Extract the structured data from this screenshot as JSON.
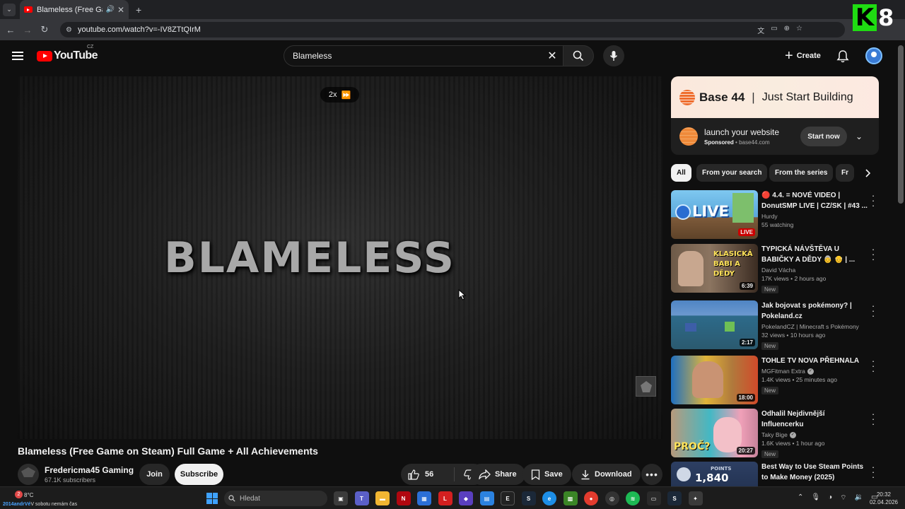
{
  "browser": {
    "tab_title": "Blameless (Free Game on Steam) Full Game + All Achievements",
    "url": "youtube.com/watch?v=-IV8ZTtQIrM",
    "badge_letter": "K",
    "badge_number": "8"
  },
  "header": {
    "logo_text": "YouTube",
    "country_code": "CZ",
    "search_value": "Blameless",
    "create_label": "Create"
  },
  "player": {
    "speed_label": "2x",
    "frame_title": "BLAMELESS"
  },
  "video": {
    "title": "Blameless (Free Game on Steam) Full Game + All Achievements",
    "channel": "Fredericma45 Gaming",
    "subscribers": "67.1K subscribers",
    "join_label": "Join",
    "subscribe_label": "Subscribe",
    "likes": "56",
    "share_label": "Share",
    "save_label": "Save",
    "download_label": "Download"
  },
  "ad": {
    "brand": "Base 44",
    "separator": "|",
    "tagline": "Just Start Building",
    "headline": "launch your website",
    "sponsored": "Sponsored",
    "dot": "•",
    "domain": "base44.com",
    "cta": "Start now"
  },
  "chips": [
    "All",
    "From your search",
    "From the series",
    "Fr"
  ],
  "recommendations": [
    {
      "title": "🔴 4.4. = NOVÉ VIDEO | DonutSMP LIVE | CZ/SK | #43 ...",
      "channel": "Hurdy",
      "stats": "55 watching",
      "badge": "LIVE",
      "thumb_text": "LIVE",
      "new": ""
    },
    {
      "title": "TYPICKÁ NÁVŠTĚVA U BABIČKY A DĚDY 👵 👴 | ...",
      "channel": "David Vácha",
      "stats": "17K views • 2 hours ago",
      "badge": "6:39",
      "thumb_text": "KLASICKÁ BABI A DĚDY",
      "new": "New"
    },
    {
      "title": "Jak bojovat s pokémony? | Pokeland.cz",
      "channel": "PokelandCZ | Minecraft s Pokémony",
      "stats": "32 views • 10 hours ago",
      "badge": "2:17",
      "thumb_text": "",
      "new": "New"
    },
    {
      "title": "TOHLE TV NOVA PŘEHNALA",
      "channel": "MGFitman Extra",
      "stats": "1.4K views • 25 minutes ago",
      "badge": "18:00",
      "thumb_text": "",
      "new": "New"
    },
    {
      "title": "Odhalil Nejdivnější Influencerku",
      "channel": "Taky Bige",
      "stats": "1.6K views • 1 hour ago",
      "badge": "20:27",
      "thumb_text": "PROČ?",
      "new": "New"
    },
    {
      "title": "Best Way to Use Steam Points to Make Money (2025)",
      "channel": "",
      "stats": "",
      "badge": "",
      "thumb_text": "1,840",
      "thumb_small": "POINTS",
      "new": ""
    }
  ],
  "taskbar": {
    "weather_badge": "2",
    "temperature": "8°C",
    "news_prefix": "2014andrVé",
    "news_text": "V sobotu nemám čas",
    "search_placeholder": "Hledat",
    "time": "20:32",
    "date": "02.04.2026"
  }
}
